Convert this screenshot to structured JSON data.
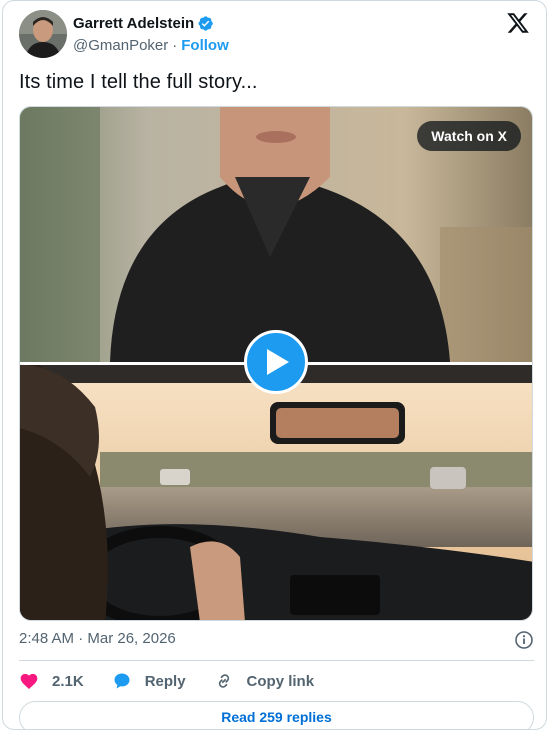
{
  "author": {
    "display_name": "Garrett Adelstein",
    "handle": "@GmanPoker",
    "separator": "·",
    "follow_label": "Follow"
  },
  "tweet": {
    "text": "Its time I tell the full story...",
    "timestamp": "2:48 AM · Mar 26, 2026"
  },
  "media": {
    "watch_label": "Watch on X",
    "play_icon": "play-icon"
  },
  "actions": {
    "like_count": "2.1K",
    "reply_label": "Reply",
    "copy_link_label": "Copy link"
  },
  "footer": {
    "read_replies_label": "Read 259 replies"
  },
  "colors": {
    "accent": "#1d9bf0",
    "like": "#f91880",
    "link_blue": "#006fd6",
    "muted": "#536471"
  }
}
